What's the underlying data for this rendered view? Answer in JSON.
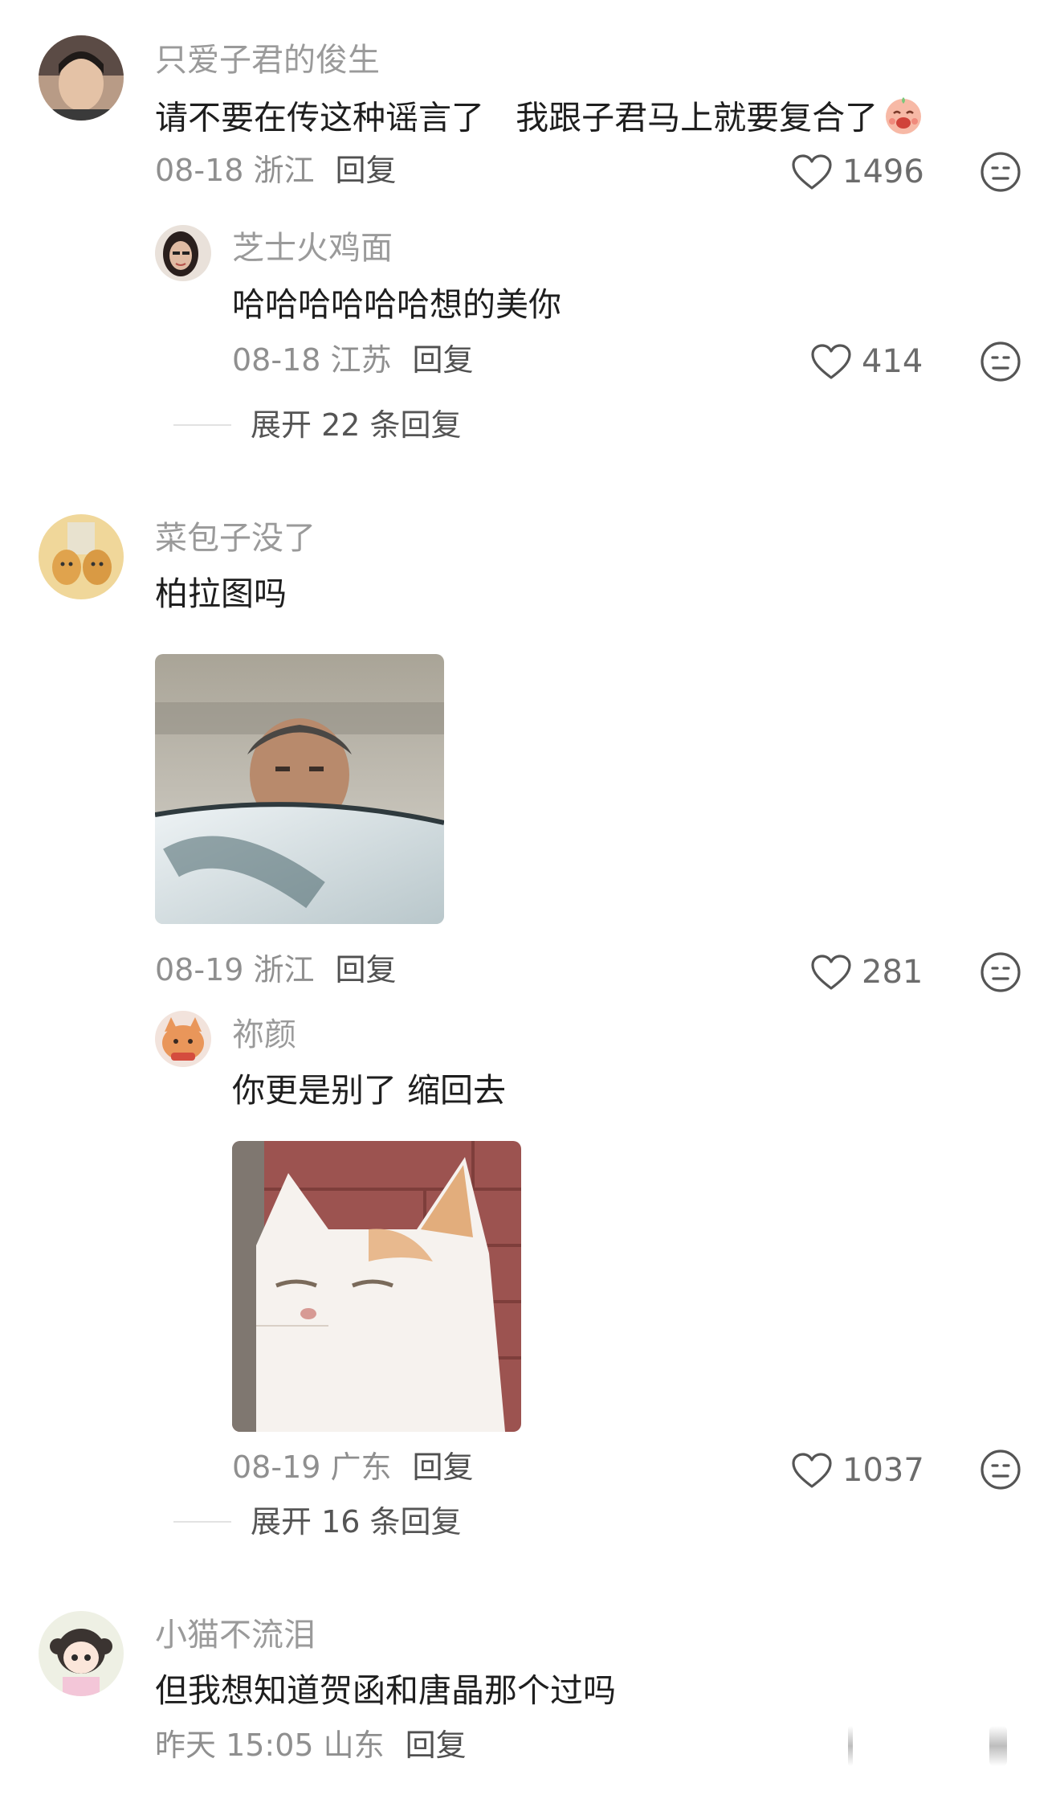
{
  "comments": [
    {
      "user": "只爱子君的俊生",
      "text": "请不要在传这种谣言了   我跟子君马上就要复合了",
      "emoji": "laughing-blush-emoji",
      "date_location": "08-18 浙江",
      "reply_label": "回复",
      "likes": "1496",
      "replies": [
        {
          "user": "芝士火鸡面",
          "text": "哈哈哈哈哈哈想的美你",
          "date_location": "08-18 江苏",
          "reply_label": "回复",
          "likes": "414"
        }
      ],
      "expand_label": "展开 22 条回复"
    },
    {
      "user": "菜包子没了",
      "text": "柏拉图吗",
      "image": "man-peeking-behind-car-photo",
      "date_location": "08-19 浙江",
      "reply_label": "回复",
      "likes": "281",
      "replies": [
        {
          "user": "祢颜",
          "text": "你更是别了 缩回去",
          "image": "squinting-cat-photo",
          "date_location": "08-19 广东",
          "reply_label": "回复",
          "likes": "1037"
        }
      ],
      "expand_label": "展开 16 条回复"
    },
    {
      "user": "小猫不流泪",
      "text": "但我想知道贺函和唐晶那个过吗",
      "date_location": "昨天 15:05 山东",
      "reply_label": "回复"
    }
  ],
  "icons": {
    "like": "heart-outline-icon",
    "dislike": "neutral-face-icon"
  },
  "colors": {
    "username": "#9a9a9a",
    "body_text": "#1e1e1e",
    "meta": "#8f8f8f",
    "icon": "#555555"
  }
}
